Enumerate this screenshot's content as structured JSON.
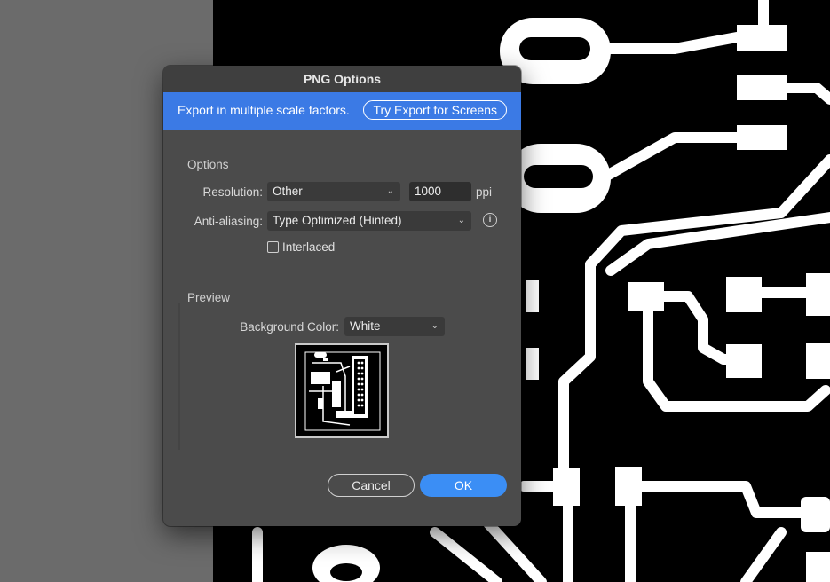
{
  "dialog": {
    "title": "PNG Options",
    "promo": {
      "text": "Export in multiple scale factors.",
      "button_label": "Try Export for Screens"
    },
    "options": {
      "section_label": "Options",
      "resolution": {
        "label": "Resolution:",
        "value": "Other",
        "ppi_value": "1000",
        "unit": "ppi"
      },
      "anti_aliasing": {
        "label": "Anti-aliasing:",
        "value": "Type Optimized (Hinted)"
      },
      "interlaced": {
        "label": "Interlaced",
        "checked": false
      }
    },
    "preview": {
      "section_label": "Preview",
      "background_color": {
        "label": "Background Color:",
        "value": "White"
      }
    },
    "buttons": {
      "cancel": "Cancel",
      "ok": "OK"
    }
  },
  "colors": {
    "promo_bar": "#3b7ae5",
    "ok_button": "#3b8ef5",
    "dialog_bg": "#4b4b4b",
    "artboard_bg": "#000000",
    "traces": "#ffffff"
  },
  "icons": {
    "select_chevron": "chevron-down-icon",
    "info": "info-icon",
    "checkbox": "checkbox-icon"
  }
}
